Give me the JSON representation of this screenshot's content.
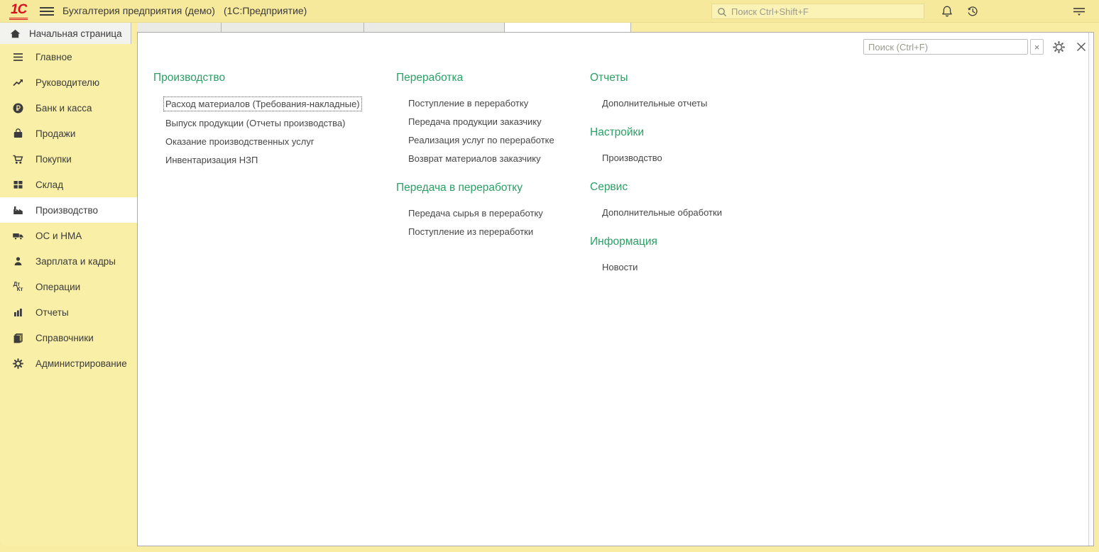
{
  "colors": {
    "accent_green": "#2aa065",
    "topbar_yellow": "#f7e99c",
    "sidebar_yellow": "#f9efa6",
    "logo_red": "#d5121e",
    "selected_item_bg": "#ffffff",
    "link_gray": "#474747"
  },
  "topbar": {
    "logo": "1С",
    "title": "Бухгалтерия предприятия (демо)",
    "subtitle": "(1С:Предприятие)",
    "search_placeholder": "Поиск Ctrl+Shift+F"
  },
  "home_tab": {
    "label": "Начальная страница"
  },
  "sidebar": {
    "items": [
      {
        "label": "Главное",
        "icon": "list-icon"
      },
      {
        "label": "Руководителю",
        "icon": "trending-up-icon"
      },
      {
        "label": "Банк и касса",
        "icon": "ruble-coin-icon"
      },
      {
        "label": "Продажи",
        "icon": "bag-icon"
      },
      {
        "label": "Покупки",
        "icon": "cart-icon"
      },
      {
        "label": "Склад",
        "icon": "grid-icon"
      },
      {
        "label": "Производство",
        "icon": "factory-icon",
        "selected": true
      },
      {
        "label": "ОС и НМА",
        "icon": "truck-icon"
      },
      {
        "label": "Зарплата и кадры",
        "icon": "person-icon"
      },
      {
        "label": "Операции",
        "icon": "debit-credit-icon",
        "debit": "Дт",
        "credit": "Кт"
      },
      {
        "label": "Отчеты",
        "icon": "bar-chart-icon"
      },
      {
        "label": "Справочники",
        "icon": "books-icon"
      },
      {
        "label": "Администрирование",
        "icon": "gear-icon"
      }
    ]
  },
  "panel": {
    "search_placeholder": "Поиск (Ctrl+F)",
    "clear_button": "×",
    "columns": [
      {
        "sections": [
          {
            "title": "Производство",
            "links": [
              {
                "label": "Расход материалов (Требования-накладные)",
                "focused": true
              },
              {
                "label": "Выпуск продукции (Отчеты производства)"
              },
              {
                "label": "Оказание производственных услуг"
              },
              {
                "label": "Инвентаризация НЗП"
              }
            ]
          }
        ]
      },
      {
        "sections": [
          {
            "title": "Переработка",
            "links": [
              {
                "label": "Поступление в переработку"
              },
              {
                "label": "Передача продукции заказчику"
              },
              {
                "label": "Реализация услуг по переработке"
              },
              {
                "label": "Возврат материалов заказчику"
              }
            ]
          },
          {
            "title": "Передача в переработку",
            "links": [
              {
                "label": "Передача сырья в переработку"
              },
              {
                "label": "Поступление из переработки"
              }
            ]
          }
        ]
      },
      {
        "sections": [
          {
            "title": "Отчеты",
            "links": [
              {
                "label": "Дополнительные отчеты"
              }
            ]
          },
          {
            "title": "Настройки",
            "links": [
              {
                "label": "Производство"
              }
            ]
          },
          {
            "title": "Сервис",
            "links": [
              {
                "label": "Дополнительные обработки"
              }
            ]
          },
          {
            "title": "Информация",
            "links": [
              {
                "label": "Новости"
              }
            ]
          }
        ]
      }
    ]
  }
}
